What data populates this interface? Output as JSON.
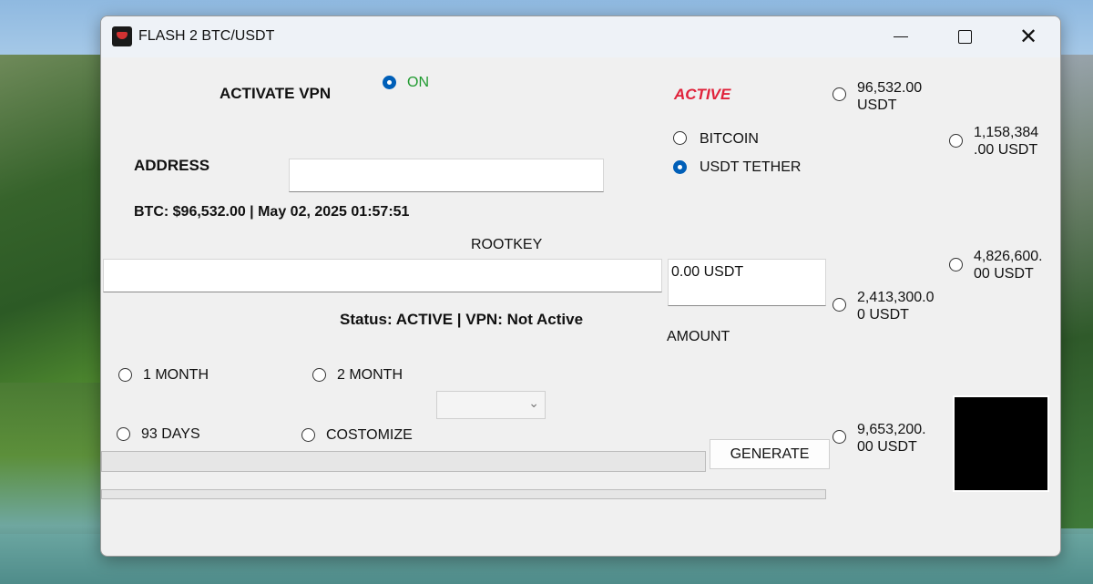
{
  "window": {
    "title": "FLASH 2 BTC/USDT"
  },
  "vpn": {
    "label": "ACTIVATE VPN",
    "option_label": "ON",
    "option_color": "#1f9a2f"
  },
  "status_badge": {
    "text": "ACTIVE",
    "color": "#e0223a"
  },
  "address": {
    "label": "ADDRESS",
    "value": ""
  },
  "ticker": "BTC: $96,532.00 | May 02, 2025 01:57:51",
  "coin": {
    "options": [
      {
        "label": "BITCOIN",
        "selected": false
      },
      {
        "label": "USDT TETHER",
        "selected": true
      }
    ]
  },
  "rootkey": {
    "label": "ROOTKEY",
    "value": ""
  },
  "amount": {
    "value": "0.00 USDT",
    "label": "AMOUNT"
  },
  "status_line": "Status: ACTIVE | VPN: Not Active",
  "durations": [
    {
      "label": "1 MONTH",
      "selected": false
    },
    {
      "label": "2 MONTH",
      "selected": false
    },
    {
      "label": "93 DAYS",
      "selected": false
    },
    {
      "label": "COSTOMIZE",
      "selected": false
    }
  ],
  "presets": [
    {
      "line1": "96,532.00",
      "line2": "USDT",
      "selected": false
    },
    {
      "line1": "1,158,384",
      "line2": ".00 USDT",
      "selected": false
    },
    {
      "line1": "4,826,600.",
      "line2": "00 USDT",
      "selected": false
    },
    {
      "line1": "2,413,300.0",
      "line2": "0 USDT",
      "selected": false
    },
    {
      "line1": "9,653,200.",
      "line2": "00 USDT",
      "selected": false
    }
  ],
  "generate_button": "GENERATE",
  "progress": {
    "primary": 0,
    "secondary": 0
  }
}
